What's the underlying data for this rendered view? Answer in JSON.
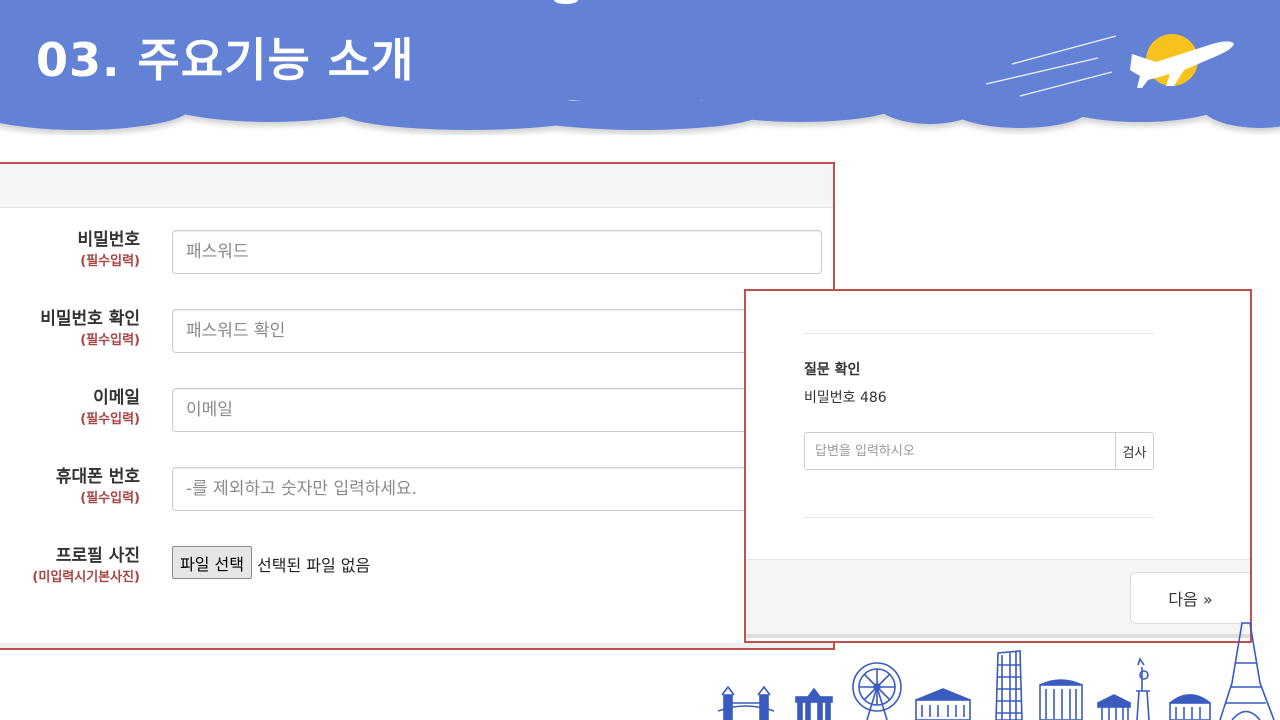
{
  "slide": {
    "title": "03. 주요기능 소개"
  },
  "colors": {
    "header_blue": "#6482d6",
    "panel_border": "#c0504d",
    "required_red": "#a94442",
    "sun_yellow": "#f8c21d",
    "skyline_blue": "#3a5bbf"
  },
  "form": {
    "fields": [
      {
        "label": "비밀번호",
        "sublabel": "(필수입력)",
        "placeholder": "패스워드"
      },
      {
        "label": "비밀번호 확인",
        "sublabel": "(필수입력)",
        "placeholder": "패스워드 확인"
      },
      {
        "label": "이메일",
        "sublabel": "(필수입력)",
        "placeholder": "이메일"
      },
      {
        "label": "휴대폰 번호",
        "sublabel": "(필수입력)",
        "placeholder": "-를 제외하고 숫자만 입력하세요."
      }
    ],
    "profile": {
      "label": "프로필 사진",
      "sublabel": "(미입력시기본사진)",
      "button_label": "파일 선택",
      "status": "선택된 파일 없음"
    }
  },
  "question_panel": {
    "title": "질문 확인",
    "question": "비밀번호 486",
    "answer_placeholder": "답변을 입력하시오",
    "check_label": "검사",
    "next_label": "다음 »"
  },
  "icons": [
    "airplane-icon",
    "sun-icon",
    "tower-bridge-icon",
    "brandenburg-gate-icon",
    "ferris-wheel-icon",
    "palace-icon",
    "leaning-tower-icon",
    "colosseum-icon",
    "parthenon-icon",
    "statue-of-liberty-icon",
    "opera-house-icon",
    "eiffel-tower-icon"
  ]
}
